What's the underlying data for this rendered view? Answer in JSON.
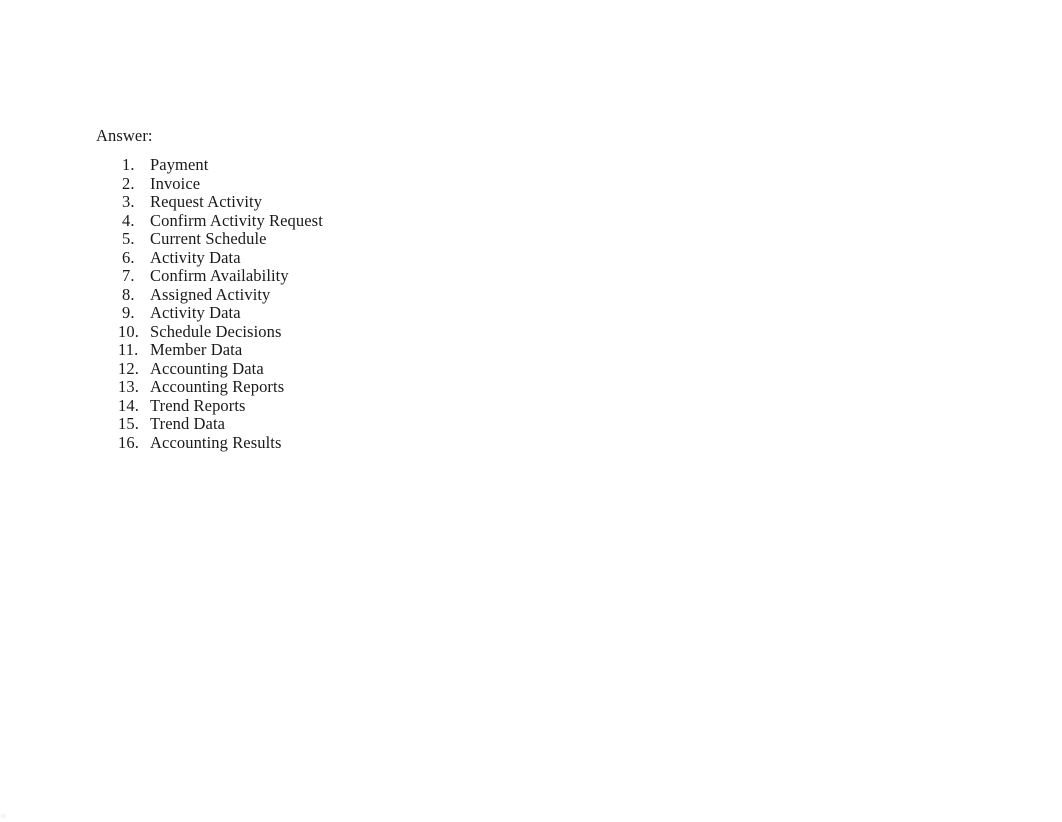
{
  "document": {
    "background_color": "#ffffff",
    "text_color": "#1a1a1a",
    "heading": "Answer:",
    "list": {
      "type": "ordered-decimal",
      "items": [
        {
          "number": "1.",
          "label": "Payment"
        },
        {
          "number": "2.",
          "label": "Invoice"
        },
        {
          "number": "3.",
          "label": "Request Activity"
        },
        {
          "number": "4.",
          "label": "Confirm Activity Request"
        },
        {
          "number": "5.",
          "label": "Current Schedule"
        },
        {
          "number": "6.",
          "label": "Activity Data"
        },
        {
          "number": "7.",
          "label": "Confirm Availability"
        },
        {
          "number": "8.",
          "label": "Assigned Activity"
        },
        {
          "number": "9.",
          "label": "Activity Data"
        },
        {
          "number": "10.",
          "label": "Schedule Decisions"
        },
        {
          "number": "11.",
          "label": "Member Data"
        },
        {
          "number": "12.",
          "label": "Accounting Data"
        },
        {
          "number": "13.",
          "label": "Accounting Reports"
        },
        {
          "number": "14.",
          "label": "Trend Reports"
        },
        {
          "number": "15.",
          "label": "Trend Data"
        },
        {
          "number": "16.",
          "label": "Accounting Results"
        }
      ]
    }
  }
}
